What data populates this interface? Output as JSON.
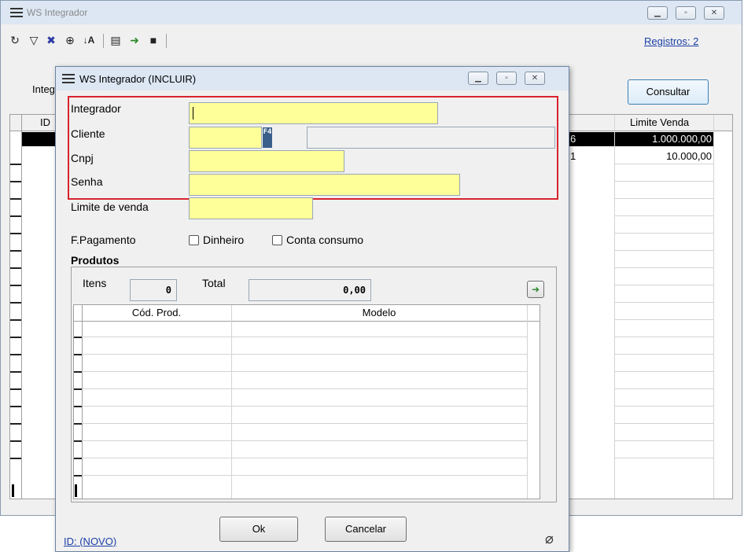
{
  "main_window": {
    "title": "WS Integrador",
    "registros_link": "Registros: 2",
    "filter_label": "Integ",
    "consultar_button": "Consultar",
    "grid": {
      "col_id": "ID",
      "col_limite": "Limite Venda",
      "rows": [
        {
          "partial": "6",
          "limite": "1.000.000,00",
          "selected": true
        },
        {
          "partial": "1",
          "limite": "10.000,00",
          "selected": false
        }
      ]
    }
  },
  "dialog": {
    "title": "WS Integrador (INCLUIR)",
    "labels": {
      "integrador": "Integrador",
      "cliente": "Cliente",
      "cnpj": "Cnpj",
      "senha": "Senha",
      "limite": "Limite de venda",
      "fpagamento": "F.Pagamento",
      "dinheiro": "Dinheiro",
      "conta_consumo": "Conta consumo",
      "produtos": "Produtos",
      "itens": "Itens",
      "total": "Total"
    },
    "f4_badge": "F4",
    "itens_value": "0",
    "total_value": "0,00",
    "products_grid": {
      "col_cod": "Cód. Prod.",
      "col_modelo": "Modelo"
    },
    "ok_button": "Ok",
    "cancel_button": "Cancelar",
    "id_link": "ID: (NOVO)"
  },
  "colors": {
    "highlight_border": "#d9232e",
    "required_field": "#ffff99",
    "titlebar": "#dce7f3"
  }
}
